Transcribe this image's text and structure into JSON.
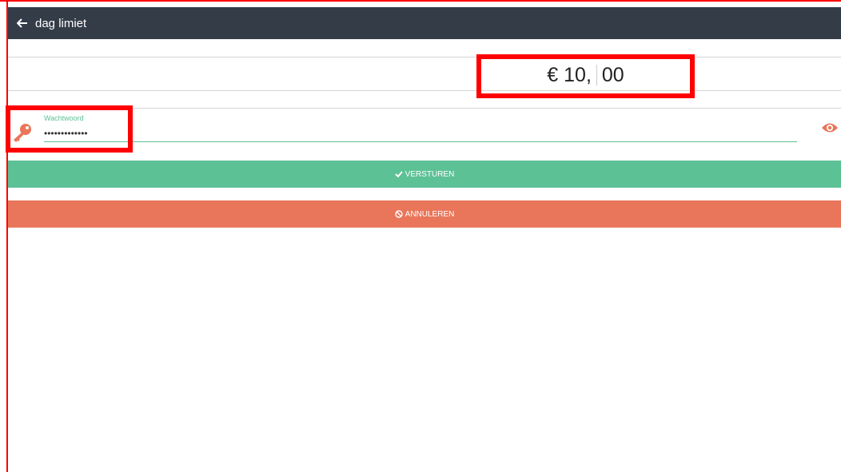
{
  "header": {
    "title": "dag limiet",
    "back_icon": "arrow-left-icon"
  },
  "amount": {
    "prefix": "€ 10,",
    "cents": "00"
  },
  "password": {
    "label": "Wachtwoord",
    "value": "•••••••••••••",
    "key_icon": "key-icon",
    "toggle_icon": "eye-icon"
  },
  "buttons": {
    "send_label": "VERSTUREN",
    "send_icon": "checkmark-icon",
    "cancel_label": "ANNULEREN",
    "cancel_icon": "ban-icon"
  },
  "colors": {
    "header_bg": "#343c48",
    "accent_green": "#5dc196",
    "accent_orange": "#e9765a",
    "highlight_red": "#ff0000"
  }
}
